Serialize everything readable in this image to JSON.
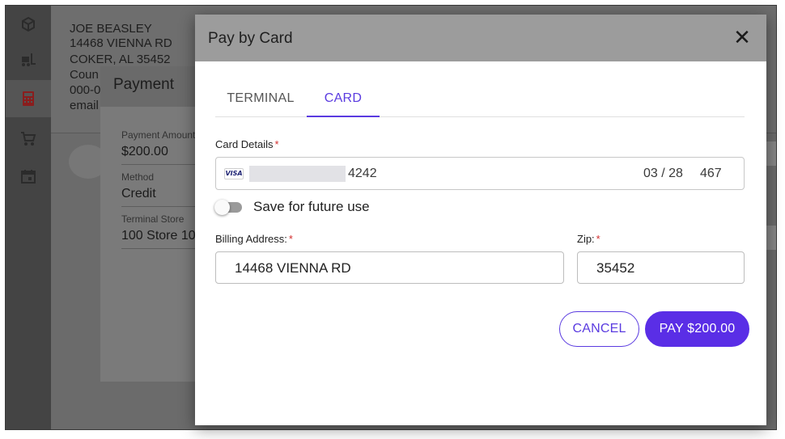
{
  "customer": {
    "name": "JOE BEASLEY",
    "address": "14468 VIENNA RD",
    "city": "COKER, AL 35452",
    "county": "Coun",
    "phone": "000-0",
    "email": "email"
  },
  "payment_dialog": {
    "title": "Payment",
    "fields": [
      {
        "label": "Payment Amount",
        "value": "$200.00"
      },
      {
        "label": "Method",
        "value": "Credit"
      },
      {
        "label": "Terminal Store",
        "value": "100 Store 10"
      }
    ]
  },
  "modal": {
    "title": "Pay by Card",
    "close_icon": "close-icon",
    "tabs": [
      {
        "label": "TERMINAL",
        "active": false
      },
      {
        "label": "CARD",
        "active": true
      }
    ],
    "card_details_label": "Card Details",
    "card": {
      "brand": "VISA",
      "last4": "4242",
      "expiry": "03 / 28",
      "cvc": "467"
    },
    "save_label": "Save for future use",
    "save_enabled": false,
    "billing_address_label": "Billing Address:",
    "billing_address": "14468 VIENNA RD",
    "zip_label": "Zip:",
    "zip": "35452",
    "required_mark": "*",
    "cancel_label": "CANCEL",
    "pay_label": "PAY $200.00"
  },
  "colors": {
    "accent": "#5a2ee6",
    "required": "#d32f2f"
  }
}
